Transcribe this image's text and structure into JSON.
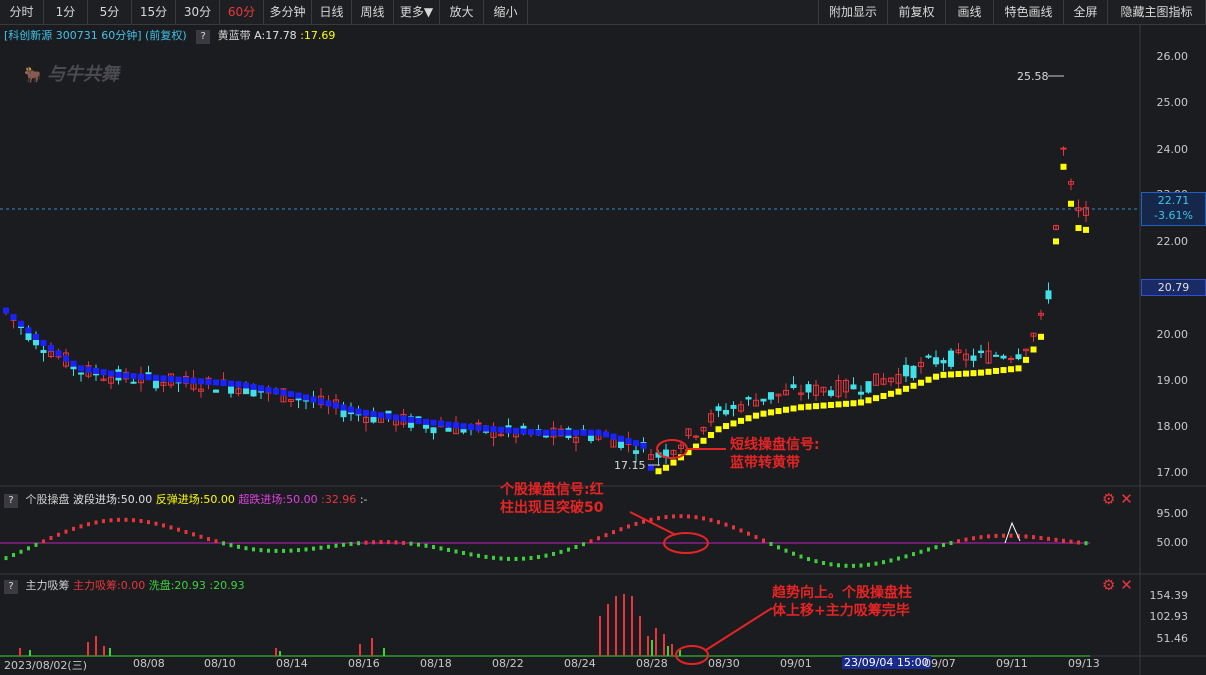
{
  "toolbar": {
    "left": [
      "分时",
      "1分",
      "5分",
      "15分",
      "30分",
      "60分",
      "多分钟",
      "日线",
      "周线",
      "更多▼",
      "放大",
      "缩小"
    ],
    "right": [
      "附加显示",
      "前复权",
      "画线",
      "特色画线",
      "全屏",
      "隐藏主图指标"
    ],
    "active": "60分"
  },
  "main_header": {
    "stock": "[科创新源 300731 60分钟] (前复权)",
    "indicator": "黄蓝带",
    "a_label": "A:17.78",
    "b_label": ":17.69",
    "watermark": "与牛共舞"
  },
  "price_axis": {
    "ticks": [
      "26.00",
      "25.00",
      "24.00",
      "23.00",
      "22.00",
      "20.00",
      "19.00",
      "18.00",
      "17.00"
    ],
    "current_price": "22.71",
    "current_change": "-3.61%",
    "marker_price": "20.79",
    "high_label": "25.58",
    "low_label": "17.15"
  },
  "panel2": {
    "name": "个股操盘",
    "wave_label": "波段进场:50.00",
    "rebound_label": "反弹进场:50.00",
    "oversold_label": "超跌进场:50.00",
    "value_label": ":32.96",
    "tail": ":-",
    "ticks": [
      "95.00",
      "50.00"
    ]
  },
  "panel3": {
    "name": "主力吸筹",
    "absorb_label": "主力吸筹:0.00",
    "wash_label": "洗盘:20.93",
    "value_label": ":20.93",
    "ticks": [
      "154.39",
      "102.93",
      "51.46"
    ]
  },
  "x_axis": {
    "labels": [
      "2023/08/02(三)",
      "08/08",
      "08/10",
      "08/14",
      "08/16",
      "08/18",
      "08/22",
      "08/24",
      "08/28",
      "08/30",
      "09/01",
      "23/09/04 15:00",
      "09/07",
      "09/11",
      "09/13"
    ]
  },
  "annotations": {
    "a1_line1": "短线操盘信号:",
    "a1_line2": "蓝带转黄带",
    "a2_line1": "个股操盘信号:红",
    "a2_line2": "柱出现且突破50",
    "a3_line1": "趋势向上。个股操盘柱",
    "a3_line2": "体上移+主力吸筹完毕"
  },
  "colors": {
    "up": "#e8353b",
    "down": "#3fe0e8",
    "yellow_band": "#ffff00",
    "blue_band": "#1a22ff",
    "annotation": "#e52424",
    "green": "#3cd23c",
    "magenta": "#c020c0"
  }
}
